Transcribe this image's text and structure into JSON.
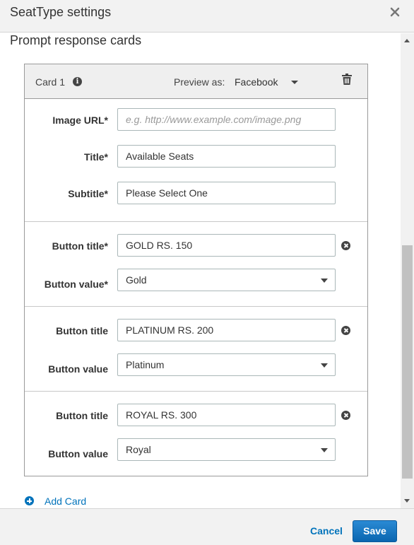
{
  "dialog": {
    "title": "SeatType settings",
    "close_icon": "close-icon"
  },
  "section": {
    "title": "Prompt response cards"
  },
  "card": {
    "name": "Card 1",
    "info_icon": "info-icon",
    "preview_label": "Preview as:",
    "preview_value": "Facebook",
    "delete_icon": "trash-icon",
    "image_url": {
      "label": "Image URL*",
      "value": "",
      "placeholder": "e.g. http://www.example.com/image.png"
    },
    "title": {
      "label": "Title*",
      "value": "Available Seats"
    },
    "subtitle": {
      "label": "Subtitle*",
      "value": "Please Select One"
    },
    "buttons": [
      {
        "title_label": "Button title*",
        "title_value": "GOLD RS. 150",
        "value_label": "Button value*",
        "value": "Gold"
      },
      {
        "title_label": "Button title",
        "title_value": "PLATINUM RS. 200",
        "value_label": "Button value",
        "value": "Platinum"
      },
      {
        "title_label": "Button title",
        "title_value": "ROYAL RS. 300",
        "value_label": "Button value",
        "value": "Royal"
      }
    ]
  },
  "add_card": {
    "label": "Add Card"
  },
  "footer": {
    "cancel_label": "Cancel",
    "save_label": "Save"
  },
  "colors": {
    "accent": "#0073bb",
    "save_bg": "#0a66b0",
    "header_bg": "#f2f2f2"
  }
}
